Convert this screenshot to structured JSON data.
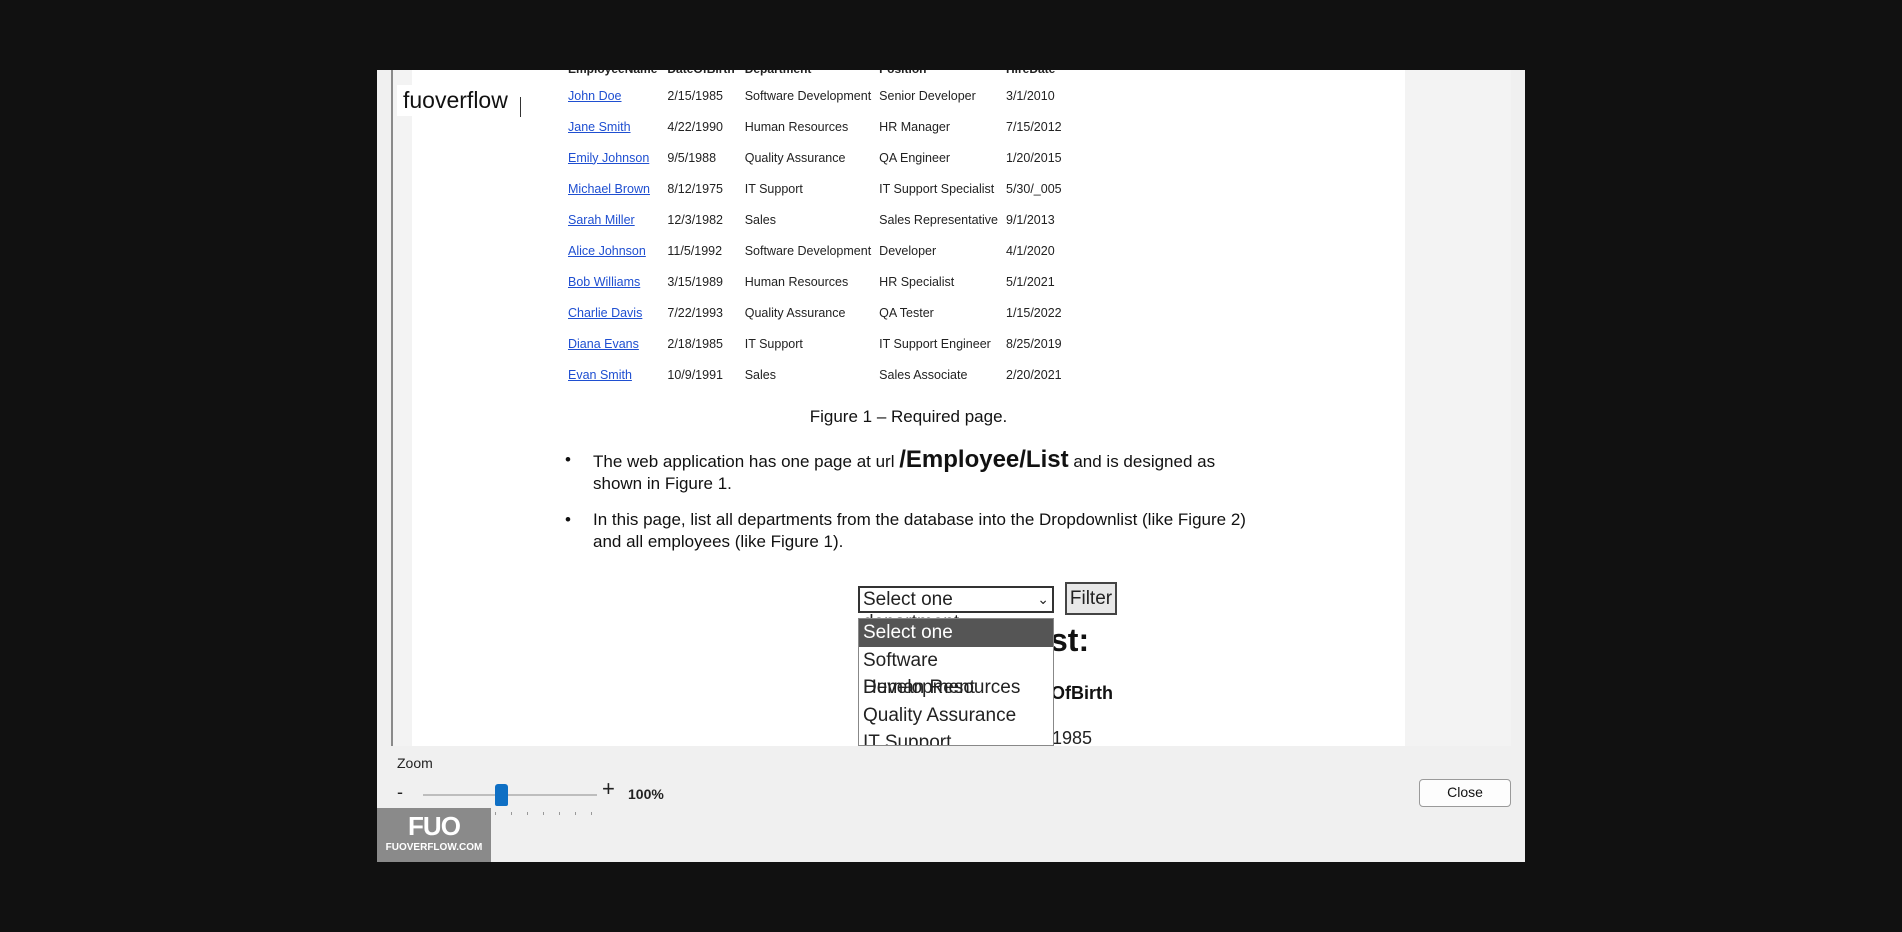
{
  "overlay_label": "fuoverflow",
  "table": {
    "columns": [
      "EmployeeName",
      "DateOfBirth",
      "Department",
      "Position",
      "HireDate"
    ],
    "rows": [
      [
        "John Doe",
        "2/15/1985",
        "Software Development",
        "Senior Developer",
        "3/1/2010"
      ],
      [
        "Jane Smith",
        "4/22/1990",
        "Human Resources",
        "HR Manager",
        "7/15/2012"
      ],
      [
        "Emily Johnson",
        "9/5/1988",
        "Quality Assurance",
        "QA Engineer",
        "1/20/2015"
      ],
      [
        "Michael Brown",
        "8/12/1975",
        "IT Support",
        "IT Support Specialist",
        "5/30/_005"
      ],
      [
        "Sarah Miller",
        "12/3/1982",
        "Sales",
        "Sales Representative",
        "9/1/2013"
      ],
      [
        "Alice Johnson",
        "11/5/1992",
        "Software Development",
        "Developer",
        "4/1/2020"
      ],
      [
        "Bob Williams",
        "3/15/1989",
        "Human Resources",
        "HR Specialist",
        "5/1/2021"
      ],
      [
        "Charlie Davis",
        "7/22/1993",
        "Quality Assurance",
        "QA Tester",
        "1/15/2022"
      ],
      [
        "Diana Evans",
        "2/18/1985",
        "IT Support",
        "IT Support Engineer",
        "8/25/2019"
      ],
      [
        "Evan Smith",
        "10/9/1991",
        "Sales",
        "Sales Associate",
        "2/20/2021"
      ]
    ]
  },
  "caption": "Figure 1 – Required page.",
  "bullet1": {
    "before": "The web application has one page at url ",
    "url": "/Employee/List",
    "after": " and is designed as shown in Figure 1."
  },
  "bullet2": "In this page, list all departments from the database into the Dropdownlist (like Figure 2) and all employees (like Figure 1).",
  "dropdown": {
    "selected": "Select one department",
    "options": [
      "Select one department",
      "Software Development",
      "Human Resources",
      "Quality Assurance",
      "IT Support"
    ]
  },
  "filter_label": "Filter",
  "behind_text": {
    "heading_fragment": "st:",
    "column_fragment": "OfBirth",
    "value_fragment": "1985"
  },
  "zoom": {
    "label": "Zoom",
    "minus": "-",
    "plus": "+",
    "value": "100%",
    "slider_fraction": 0.45
  },
  "close_label": "Close",
  "logo": {
    "mark": "FUO",
    "site": "FUOVERFLOW.COM"
  },
  "colors": {
    "link": "#1f4fd1",
    "slider_thumb": "#0e6fc4",
    "selected_option_bg": "#555555"
  }
}
